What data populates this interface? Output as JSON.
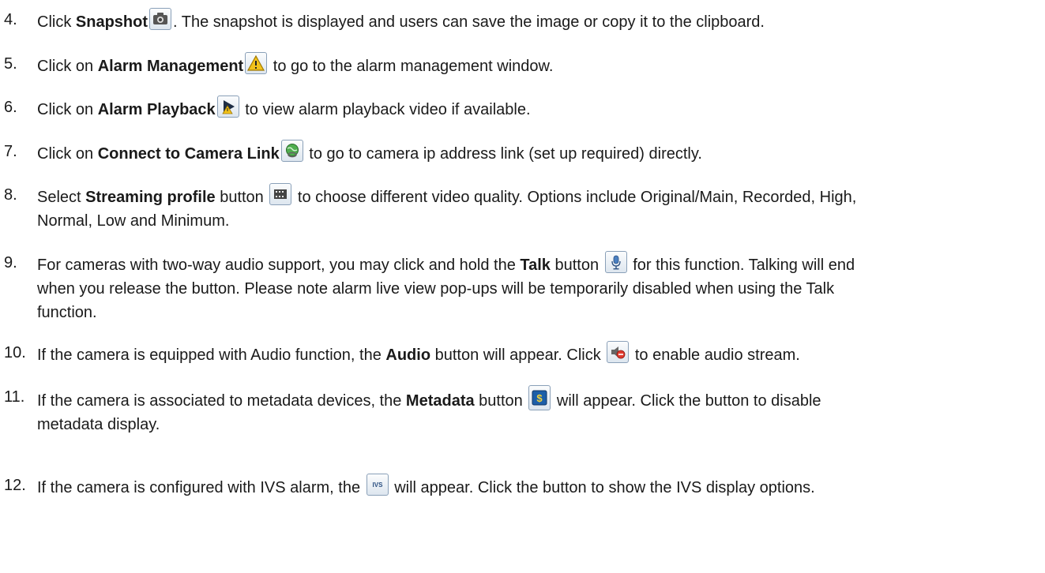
{
  "items": [
    {
      "num": "4.",
      "pre": "Click ",
      "bold": "Snapshot",
      "post": ". The snapshot is displayed and users can save the image or copy it to the clipboard.",
      "icon": "camera-icon"
    },
    {
      "num": "5.",
      "pre": "Click on ",
      "bold": "Alarm Management",
      "post": " to go to the alarm management window.",
      "icon": "warning-icon"
    },
    {
      "num": "6.",
      "pre": "Click on ",
      "bold": "Alarm Playback",
      "post": " to view alarm playback video if available.",
      "icon": "playback-icon"
    },
    {
      "num": "7.",
      "pre": "Click on ",
      "bold": "Connect to Camera Link",
      "post": " to go to camera ip address link (set up required) directly.",
      "icon": "globe-link-icon"
    },
    {
      "num": "8.",
      "pre": "Select ",
      "bold": "Streaming profile",
      "mid": " button ",
      "post": " to choose different video quality.  Options include Original/Main, Recorded, High,",
      "post2": "Normal, Low and Minimum.",
      "icon": "film-icon"
    },
    {
      "num": "9.",
      "pre": "For cameras with two-way audio support, you may click and hold the ",
      "bold": "Talk",
      "mid": " button ",
      "post": " for this function.  Talking will end",
      "post2": "when you release the button.  Please note alarm live view pop-ups will be temporarily disabled when using the Talk",
      "post3": "function.",
      "icon": "microphone-icon"
    },
    {
      "num": "10.",
      "pre": "If the camera is equipped with Audio function, the ",
      "bold": "Audio",
      "mid": " button will appear. Click ",
      "post": " to enable audio stream.",
      "icon": "audio-muted-icon"
    },
    {
      "num": "11.",
      "pre": "If the camera is associated to metadata devices, the ",
      "bold": "Metadata",
      "mid": " button ",
      "post": " will appear. Click the button to disable",
      "post2": "metadata display.",
      "icon": "metadata-dollar-icon"
    },
    {
      "num": "12.",
      "pre": "If the camera is configured with IVS alarm, the ",
      "post": " will appear. Click the button to show the IVS display options.",
      "icon": "ivs-icon",
      "icon_text": "IVS"
    }
  ],
  "colors": {
    "text": "#1a1a1a",
    "icon_border": "#8aa0b8",
    "warning": "#f2c21b",
    "globe": "#3a9a3a",
    "mic": "#4a7fc0",
    "metadata": "#1d5fa8"
  }
}
